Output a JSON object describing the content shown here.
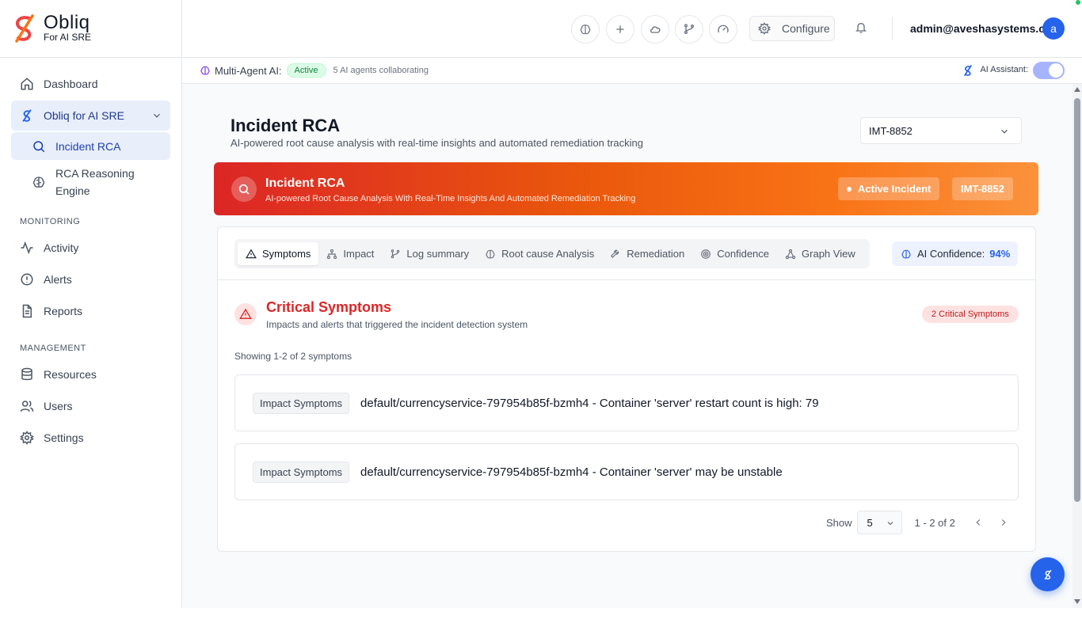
{
  "brand": {
    "name": "Obliq",
    "subtitle": "For AI SRE"
  },
  "sidebar": {
    "dashboard": "Dashboard",
    "group": "Obliq for AI SRE",
    "incident_rca": "Incident RCA",
    "rca_engine_line1": "RCA Reasoning",
    "rca_engine_line2": "Engine",
    "monitoring_title": "MONITORING",
    "activity": "Activity",
    "alerts": "Alerts",
    "reports": "Reports",
    "management_title": "MANAGEMENT",
    "resources": "Resources",
    "users": "Users",
    "settings": "Settings"
  },
  "topbar": {
    "configure": "Configure",
    "user_email": "admin@aveshasystems.com",
    "avatar_initial": "a"
  },
  "subbar": {
    "multi_agent": "Multi-Agent AI:",
    "status": "Active",
    "agents": "5 AI agents collaborating",
    "assistant": "AI Assistant:"
  },
  "page": {
    "title": "Incident RCA",
    "subtitle": "AI-powered root cause analysis with real-time insights and automated remediation tracking",
    "incident_select": "IMT-8852"
  },
  "banner": {
    "title": "Incident RCA",
    "subtitle": "AI-powered Root Cause Analysis With Real-Time Insights And Automated Remediation Tracking",
    "status": "Active Incident",
    "incident_id": "IMT-8852"
  },
  "tabs": [
    {
      "label": "Symptoms",
      "icon": "warning-icon"
    },
    {
      "label": "Impact",
      "icon": "network-icon"
    },
    {
      "label": "Log summary",
      "icon": "branch-icon"
    },
    {
      "label": "Root cause Analysis",
      "icon": "brain-icon"
    },
    {
      "label": "Remediation",
      "icon": "wrench-icon"
    },
    {
      "label": "Confidence",
      "icon": "target-icon"
    },
    {
      "label": "Graph View",
      "icon": "graph-icon"
    }
  ],
  "confidence": {
    "label": "AI Confidence:",
    "value": "94%"
  },
  "symptoms": {
    "title": "Critical Symptoms",
    "subtitle": "Impacts and alerts that triggered the incident detection system",
    "badge": "2 Critical Symptoms",
    "showing": "Showing 1-2 of 2 symptoms",
    "items": [
      {
        "tag": "Impact Symptoms",
        "text": "default/currencyservice-797954b85f-bzmh4 - Container 'server' restart count is high: 79"
      },
      {
        "tag": "Impact Symptoms",
        "text": "default/currencyservice-797954b85f-bzmh4 - Container 'server' may be unstable"
      }
    ]
  },
  "pager": {
    "show_label": "Show",
    "page_size": "5",
    "range": "1 - 2 of 2"
  },
  "colors": {
    "accent": "#2563eb",
    "danger": "#dc2626",
    "banner_start": "#dc2626",
    "banner_end": "#fb923c"
  }
}
